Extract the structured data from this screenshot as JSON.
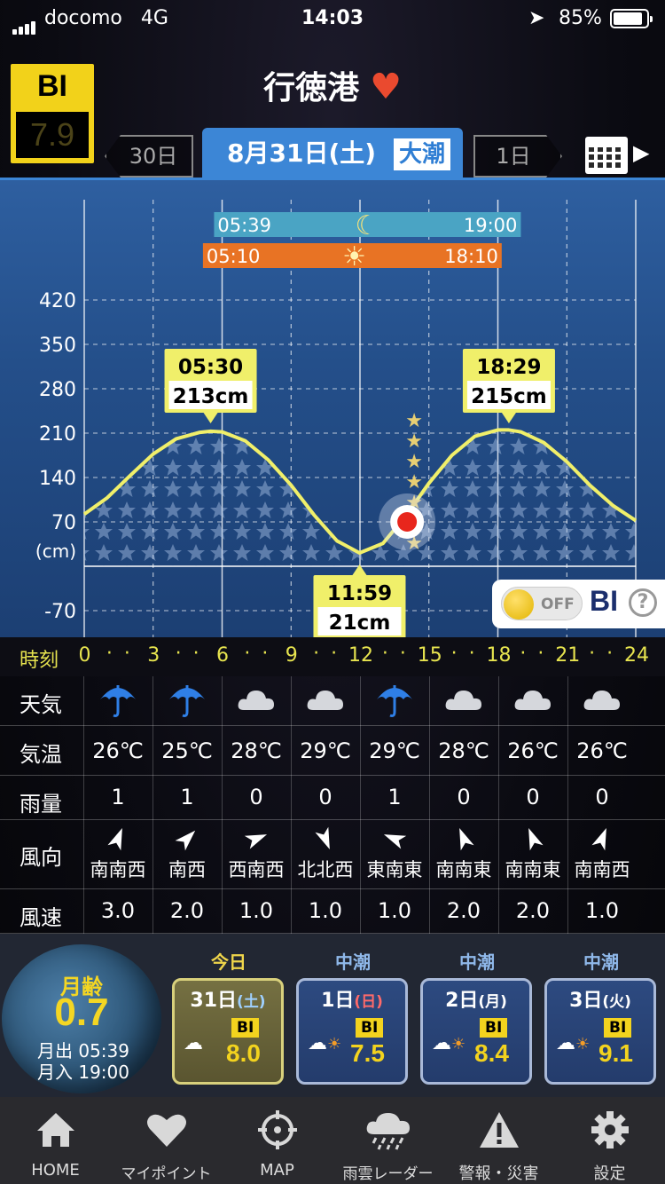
{
  "status": {
    "carrier": "docomo",
    "network": "4G",
    "time": "14:03",
    "battery": "85%"
  },
  "header": {
    "bi_label": "BI",
    "bi_value": "7.9",
    "port_name": "行徳港",
    "prev_label": "30日",
    "next_label": "1日",
    "date": "8月31日(土)",
    "tide_type": "大潮"
  },
  "sun_moon": {
    "moon_rise": "05:39",
    "moon_set": "19:00",
    "sun_rise": "05:10",
    "sun_set": "18:10"
  },
  "chart_data": {
    "type": "line",
    "unit_label": "(cm)",
    "y_ticks": [
      "420",
      "350",
      "280",
      "210",
      "140",
      "70",
      "-70"
    ],
    "ylim": [
      -70,
      420
    ],
    "xlim": [
      0,
      24
    ],
    "x_label": "時刻",
    "x_ticks": [
      "0",
      "3",
      "6",
      "9",
      "12",
      "15",
      "18",
      "21",
      "24"
    ],
    "series": [
      {
        "x": [
          0,
          1,
          2,
          3,
          4,
          5,
          5.5,
          6,
          7,
          8,
          9,
          10,
          11,
          11.98,
          13,
          14,
          15,
          16,
          17,
          18,
          18.48,
          19,
          20,
          21,
          22,
          23,
          24
        ],
        "values": [
          82,
          108,
          143,
          177,
          201,
          211,
          213,
          212,
          198,
          168,
          128,
          81,
          40,
          21,
          36,
          80,
          131,
          175,
          205,
          215,
          215,
          212,
          195,
          165,
          128,
          96,
          72
        ]
      }
    ],
    "annotations": [
      {
        "time": "05:30",
        "height": "213cm"
      },
      {
        "time": "11:59",
        "height": "21cm"
      },
      {
        "time": "18:29",
        "height": "215cm"
      }
    ],
    "current_time": 14.05,
    "current_value": 70
  },
  "bi_toggle": {
    "state": "OFF",
    "label": "BI",
    "help": "?"
  },
  "weather": {
    "labels": {
      "weather": "天気",
      "temp": "気温",
      "rain": "雨量",
      "wind_dir": "風向",
      "wind_speed": "風速"
    },
    "columns": [
      {
        "icon": "umbrella",
        "temp": "26℃",
        "rain": "1",
        "dir": "南南西",
        "deg": 202,
        "speed": "3.0"
      },
      {
        "icon": "umbrella",
        "temp": "25℃",
        "rain": "1",
        "dir": "南西",
        "deg": 225,
        "speed": "2.0"
      },
      {
        "icon": "cloud",
        "temp": "28℃",
        "rain": "0",
        "dir": "西南西",
        "deg": 248,
        "speed": "1.0"
      },
      {
        "icon": "cloud",
        "temp": "29℃",
        "rain": "0",
        "dir": "北北西",
        "deg": 338,
        "speed": "1.0"
      },
      {
        "icon": "umbrella",
        "temp": "29℃",
        "rain": "1",
        "dir": "東南東",
        "deg": 112,
        "speed": "1.0"
      },
      {
        "icon": "cloud",
        "temp": "28℃",
        "rain": "0",
        "dir": "南南東",
        "deg": 158,
        "speed": "2.0"
      },
      {
        "icon": "cloud",
        "temp": "26℃",
        "rain": "0",
        "dir": "南南東",
        "deg": 158,
        "speed": "2.0"
      },
      {
        "icon": "cloud",
        "temp": "26℃",
        "rain": "0",
        "dir": "南南西",
        "deg": 202,
        "speed": "1.0"
      }
    ]
  },
  "moon": {
    "age_label": "月齢",
    "age_value": "0.7",
    "rise": "月出 05:39",
    "set": "月入 19:00"
  },
  "days": [
    {
      "tide": "今日",
      "day": "31日",
      "weekday": "(土)",
      "bi": "8.0",
      "bi_label": "BI"
    },
    {
      "tide": "中潮",
      "day": "1日",
      "weekday": "(日)",
      "bi": "7.5",
      "bi_label": "BI"
    },
    {
      "tide": "中潮",
      "day": "2日",
      "weekday": "(月)",
      "bi": "8.4",
      "bi_label": "BI"
    },
    {
      "tide": "中潮",
      "day": "3日",
      "weekday": "(火)",
      "bi": "9.1",
      "bi_label": "BI"
    }
  ],
  "tabs": [
    {
      "label": "HOME",
      "icon": "home-icon"
    },
    {
      "label": "マイポイント",
      "icon": "heart-icon"
    },
    {
      "label": "MAP",
      "icon": "crosshair-icon"
    },
    {
      "label": "雨雲レーダー",
      "icon": "rain-cloud-icon"
    },
    {
      "label": "警報・災害",
      "icon": "warning-icon"
    },
    {
      "label": "設定",
      "icon": "gear-icon"
    }
  ]
}
